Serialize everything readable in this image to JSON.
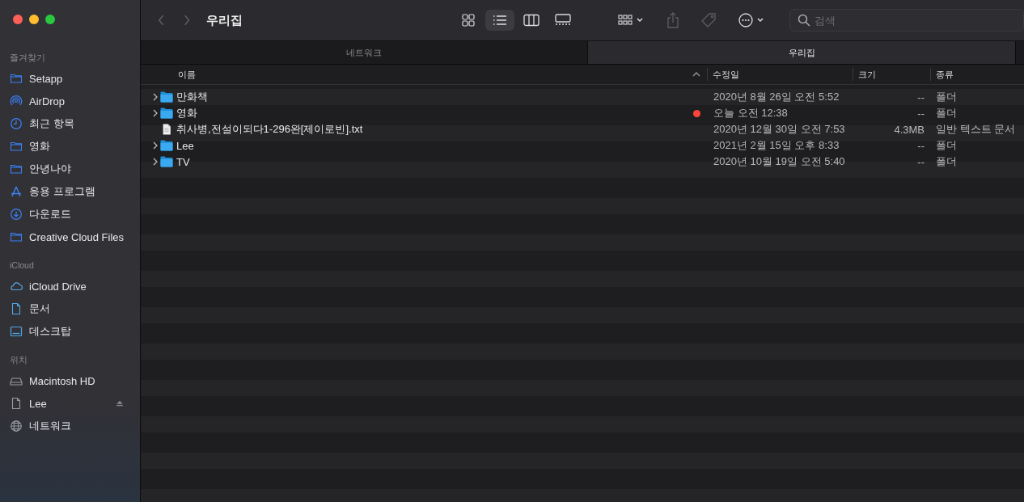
{
  "window": {
    "title": "우리집"
  },
  "sidebar": {
    "sections": [
      {
        "heading": "즐겨찾기",
        "items": [
          {
            "kind": "folder",
            "label": "Setapp"
          },
          {
            "kind": "airdrop",
            "label": "AirDrop"
          },
          {
            "kind": "clock",
            "label": "최근 항목"
          },
          {
            "kind": "folder",
            "label": "영화"
          },
          {
            "kind": "folder",
            "label": "안녕나야"
          },
          {
            "kind": "apps",
            "label": "응용 프로그램"
          },
          {
            "kind": "download",
            "label": "다운로드"
          },
          {
            "kind": "folder",
            "label": "Creative Cloud Files"
          }
        ]
      },
      {
        "heading": "iCloud",
        "items": [
          {
            "kind": "cloud",
            "label": "iCloud Drive"
          },
          {
            "kind": "document",
            "label": "문서"
          },
          {
            "kind": "desktop",
            "label": "데스크탑"
          }
        ]
      },
      {
        "heading": "위치",
        "items": [
          {
            "kind": "disk",
            "label": "Macintosh HD"
          },
          {
            "kind": "volume",
            "label": "Lee"
          },
          {
            "kind": "network",
            "label": "네트워크"
          }
        ]
      }
    ]
  },
  "toolbar": {
    "back": {
      "disabled": true
    },
    "forward": {
      "disabled": true
    },
    "view_modes": [
      {
        "kind": "icons",
        "selected": false
      },
      {
        "kind": "list",
        "selected": true
      },
      {
        "kind": "columns",
        "selected": false
      },
      {
        "kind": "gallery",
        "selected": false
      }
    ],
    "share": {
      "disabled": true
    },
    "tags": {
      "disabled": true
    },
    "search": {
      "placeholder": "검색"
    }
  },
  "tabs": [
    {
      "label": "네트워크",
      "selected": false
    },
    {
      "label": "우리집",
      "selected": true
    }
  ],
  "table": {
    "columns": [
      "이름",
      "수정일",
      "크기",
      "종류"
    ],
    "rows": [
      {
        "kind": "folder",
        "name": "만화책",
        "modified": "2020년 8월 26일 오전 5:52",
        "size": "--",
        "type": "폴더"
      },
      {
        "kind": "folder",
        "name": "영화",
        "color": "#ff453a",
        "modified": "오늘 오전 12:38",
        "size": "--",
        "type": "폴더"
      },
      {
        "kind": "file",
        "name": "취사병,전설이되다1-296완[제이로빈].txt",
        "modified": "2020년 12월 30일 오전 7:53",
        "size": "4.3MB",
        "type": "일반 텍스트 문서"
      },
      {
        "kind": "folder",
        "name": "Lee",
        "modified": "2021년 2월 15일 오후 8:33",
        "size": "--",
        "type": "폴더"
      },
      {
        "kind": "folder",
        "name": "TV",
        "modified": "2020년 10월 19일 오전 5:40",
        "size": "--",
        "type": "폴더"
      }
    ]
  }
}
